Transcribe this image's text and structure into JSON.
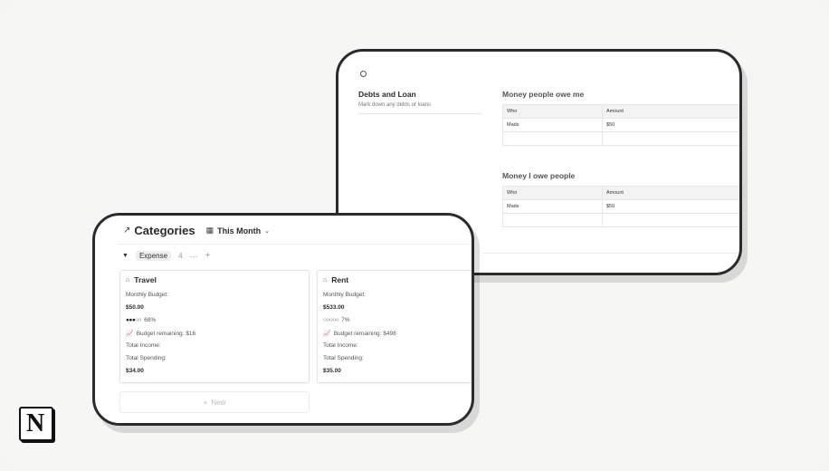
{
  "debts": {
    "title": "Debts and Loan",
    "subtitle": "Mark down any debts or loans"
  },
  "owe_me": {
    "title": "Money people owe me",
    "headers": [
      "Who",
      "Amount"
    ],
    "rows": [
      [
        "Mads",
        "$50"
      ],
      [
        "",
        ""
      ]
    ]
  },
  "i_owe": {
    "title": "Money I owe people",
    "headers": [
      "Who",
      "Amount"
    ],
    "rows": [
      [
        "Mads",
        "$50"
      ],
      [
        "",
        ""
      ]
    ]
  },
  "categories": {
    "title": "Categories",
    "view": "This Month",
    "group": {
      "tag": "Expense",
      "count": "4"
    },
    "new_label": "New",
    "cards": [
      {
        "icon": "wallet-icon",
        "name": "Travel",
        "budget_label": "Monthly Budget:",
        "budget_value": "$50.00",
        "progress_dots": "●●●○○",
        "progress_pct": "68%",
        "remaining": "Budget remaining: $16",
        "income_label": "Total Income:",
        "spending_label": "Total Spending:",
        "spending_value": "$34.00"
      },
      {
        "icon": "home-icon",
        "name": "Rent",
        "budget_label": "Monthly Budget:",
        "budget_value": "$533.00",
        "progress_dots": "○○○○○",
        "progress_pct": "7%",
        "remaining": "Budget remaining: $498",
        "income_label": "Total Income:",
        "spending_label": "Total Spending:",
        "spending_value": "$35.00"
      }
    ]
  },
  "logo": {
    "letter": "N"
  }
}
